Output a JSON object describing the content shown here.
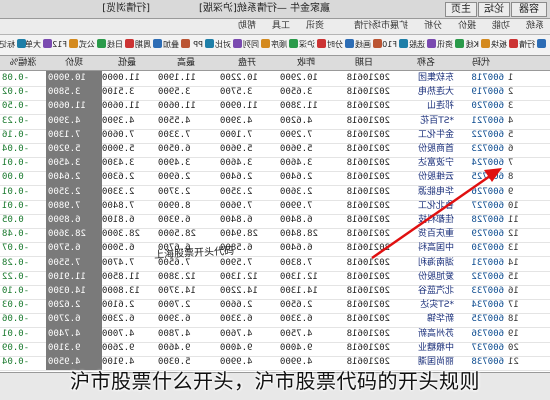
{
  "caption": "沪市股票什么开头，沪市股票代码的开头规则",
  "annotation": "上海股票开头代码",
  "topbar": {
    "buttons": [
      "容器",
      "论坛",
      "主页"
    ],
    "title": "赢家金牛 —行情系统[沪深版]",
    "right_label": "[行情浏览]"
  },
  "menubar": {
    "items": [
      "系统",
      "功能",
      "报价",
      "分析",
      "扩展市场行情",
      "资讯",
      "工具",
      "帮助"
    ]
  },
  "toolbar": {
    "items": [
      "行情",
      "板块",
      "K线",
      "资讯",
      "选股",
      "F10",
      "画线",
      "分时",
      "沪深",
      "顺序",
      "同列",
      "对比",
      "PP",
      "叠加",
      "周期",
      "日线",
      "公式",
      "F12",
      "大单",
      "标记"
    ]
  },
  "columns": [
    "",
    "代码",
    "名称",
    "日期",
    "昨收",
    "开盘",
    "最高",
    "最低",
    "现价",
    "涨幅%"
  ],
  "rows": [
    {
      "rn": "1",
      "code": "600718",
      "name": "东软集团",
      "date": "20210618",
      "close": "10.2900",
      "open": "10.2200",
      "high": "11.1900",
      "low": "11.0000",
      "now": "10.9000",
      "chg": "-0.08"
    },
    {
      "rn": "2",
      "code": "600719",
      "name": "大连热电",
      "date": "20210618",
      "close": "3.6500",
      "open": "3.5700",
      "high": "3.5900",
      "low": "3.5100",
      "now": "3.5800",
      "chg": "-0.02"
    },
    {
      "rn": "3",
      "code": "600720",
      "name": "祁连山",
      "date": "20210618",
      "close": "11.3800",
      "open": "11.0900",
      "high": "11.0600",
      "low": "11.0600",
      "now": "11.0600",
      "chg": "-0.50"
    },
    {
      "rn": "4",
      "code": "600721",
      "name": "*ST百花",
      "date": "20210618",
      "close": "4.6200",
      "open": "4.3900",
      "high": "4.5500",
      "low": "4.3900",
      "now": "4.3900",
      "chg": "-0.23"
    },
    {
      "rn": "5",
      "code": "600722",
      "name": "金牛化工",
      "date": "20210618",
      "close": "7.2900",
      "open": "7.1000",
      "high": "7.3300",
      "low": "7.0600",
      "now": "7.1300",
      "chg": "-0.16"
    },
    {
      "rn": "6",
      "code": "600723",
      "name": "首商股份",
      "date": "20210618",
      "close": "5.9600",
      "open": "5.9600",
      "high": "6.0500",
      "low": "5.9000",
      "now": "5.9200",
      "chg": "-0.04"
    },
    {
      "rn": "7",
      "code": "600724",
      "name": "宁波富达",
      "date": "20210618",
      "close": "3.4600",
      "open": "3.4600",
      "high": "3.4900",
      "low": "3.4300",
      "now": "3.4500",
      "chg": "-0.01"
    },
    {
      "rn": "8",
      "code": "600725",
      "name": "云维股份",
      "date": "20210618",
      "close": "2.6400",
      "open": "2.6400",
      "high": "2.6900",
      "low": "2.6300",
      "now": "2.6400",
      "chg": "0.00"
    },
    {
      "rn": "9",
      "code": "600726",
      "name": "华电能源",
      "date": "20210618",
      "close": "2.3600",
      "open": "2.3500",
      "high": "2.3700",
      "low": "2.3300",
      "now": "2.3500",
      "chg": "-0.01"
    },
    {
      "rn": "10",
      "code": "600727",
      "name": "鲁北化工",
      "date": "20210618",
      "close": "7.9900",
      "open": "7.9600",
      "high": "8.0900",
      "low": "7.8400",
      "now": "7.9800",
      "chg": "-0.01"
    },
    {
      "rn": "11",
      "code": "600728",
      "name": "佳都科技",
      "date": "20210618",
      "close": "6.8400",
      "open": "6.8400",
      "high": "6.9300",
      "low": "6.8100",
      "now": "6.8900",
      "chg": "0.05"
    },
    {
      "rn": "12",
      "code": "600729",
      "name": "重庆百货",
      "date": "20210618",
      "close": "28.8400",
      "open": "28.9400",
      "high": "28.5000",
      "low": "28.3000",
      "now": "28.3600",
      "chg": "-0.48"
    },
    {
      "rn": "13",
      "code": "600730",
      "name": "中国高科",
      "date": "20210618",
      "close": "6.6400",
      "open": "6.5800",
      "high": "6.6700",
      "low": "6.5000",
      "now": "6.5700",
      "chg": "-0.07"
    },
    {
      "rn": "14",
      "code": "600731",
      "name": "湖南海利",
      "date": "20210618",
      "close": "7.8300",
      "open": "7.5900",
      "high": "7.6500",
      "low": "7.4700",
      "now": "7.5500",
      "chg": "-0.28"
    },
    {
      "rn": "15",
      "code": "600732",
      "name": "爱旭股份",
      "date": "20210618",
      "close": "12.1300",
      "open": "12.1300",
      "high": "12.3800",
      "low": "11.8500",
      "now": "11.9100",
      "chg": "-0.22"
    },
    {
      "rn": "16",
      "code": "600733",
      "name": "北汽蓝谷",
      "date": "20210618",
      "close": "14.1300",
      "open": "14.2200",
      "high": "14.3700",
      "low": "13.8000",
      "now": "14.0300",
      "chg": "-0.10"
    },
    {
      "rn": "17",
      "code": "600734",
      "name": "*ST实达",
      "date": "20210618",
      "close": "2.6500",
      "open": "2.6600",
      "high": "2.7000",
      "low": "2.6100",
      "now": "2.6200",
      "chg": "-0.03"
    },
    {
      "rn": "18",
      "code": "600735",
      "name": "新华锦",
      "date": "20210618",
      "close": "6.3300",
      "open": "6.3300",
      "high": "6.3900",
      "low": "6.2300",
      "now": "6.2700",
      "chg": "-0.06"
    },
    {
      "rn": "19",
      "code": "600736",
      "name": "苏州高新",
      "date": "20210618",
      "close": "4.7500",
      "open": "4.7600",
      "high": "4.7800",
      "low": "4.7000",
      "now": "4.7400",
      "chg": "-0.01"
    },
    {
      "rn": "20",
      "code": "600737",
      "name": "中粮糖业",
      "date": "20210618",
      "close": "9.4000",
      "open": "9.4000",
      "high": "9.4600",
      "low": "9.2600",
      "now": "9.3100",
      "chg": "-0.09"
    },
    {
      "rn": "21",
      "code": "600738",
      "name": "丽尚国潮",
      "date": "20210618",
      "close": "4.9900",
      "open": "4.9900",
      "high": "5.0300",
      "low": "4.9100",
      "now": "4.9500",
      "chg": "-0.04"
    }
  ]
}
